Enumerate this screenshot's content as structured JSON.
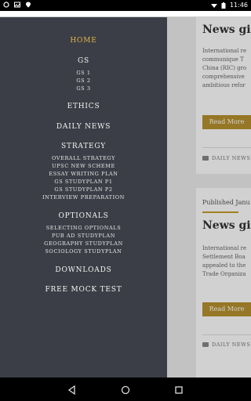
{
  "status_bar": {
    "time": "11:46",
    "left_icons": [
      "ring-icon",
      "photo-icon",
      "location-icon"
    ],
    "right_icons": [
      "wifi-icon",
      "battery-icon"
    ]
  },
  "drawer": {
    "items": [
      {
        "label": "HOME",
        "active": true
      },
      {
        "label": "GS",
        "subitems": [
          "GS 1",
          "GS 2",
          "GS 3"
        ]
      },
      {
        "label": "ETHICS"
      },
      {
        "label": "DAILY NEWS"
      },
      {
        "label": "STRATEGY",
        "subitems": [
          "OVERALL STRATEGY",
          "UPSC NEW SCHEME",
          "ESSAY WRITING PLAN",
          "GS STUDYPLAN P1",
          "GS STUDYPLAN P2",
          "INTERVIEW PREPARATION"
        ]
      },
      {
        "label": "OPTIONALS",
        "subitems": [
          "SELECTING OPTIONALS",
          "PUB AD STUDYPLAN",
          "GEOGRAPHY STUDYPLAN",
          "SOCIOLOGY STUDYPLAN"
        ]
      },
      {
        "label": "DOWNLOADS"
      },
      {
        "label": "FREE MOCK TEST"
      }
    ]
  },
  "cards": [
    {
      "title": "News gist",
      "body_lines": [
        "International re",
        "communique T",
        "China (RIC) gro",
        "comprehensive",
        "ambitious refor"
      ],
      "read_more": "Read More",
      "category": "DAILY NEWS"
    },
    {
      "published": "Published Janu",
      "title": "News gist",
      "body_lines": [
        "International re",
        "Settlement Boa",
        "appealed to the",
        "Trade Organiza"
      ],
      "read_more": "Read More",
      "category": "DAILY NEWS"
    }
  ],
  "colors": {
    "drawer_bg": "#3b3e46",
    "active": "#e3b445",
    "button": "#b8922f"
  }
}
